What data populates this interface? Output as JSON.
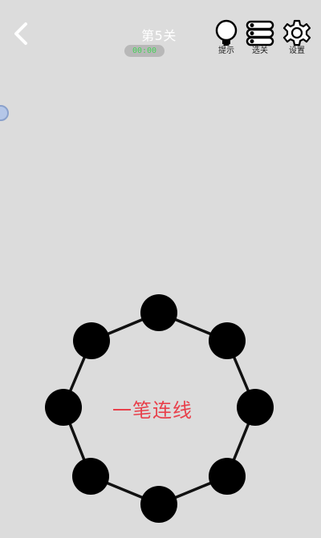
{
  "header": {
    "level_title": "第5关",
    "timer": "00:00"
  },
  "tools": {
    "hint_label": "提示",
    "select_label": "选关",
    "settings_label": "设置"
  },
  "puzzle": {
    "center_text": "一笔连线",
    "node_count": 8,
    "edges_count": 8
  },
  "colors": {
    "background": "#dcdcdc",
    "node": "#000000",
    "edge": "#111111",
    "center_text": "#e8404b",
    "timer_text": "#48d15a"
  }
}
